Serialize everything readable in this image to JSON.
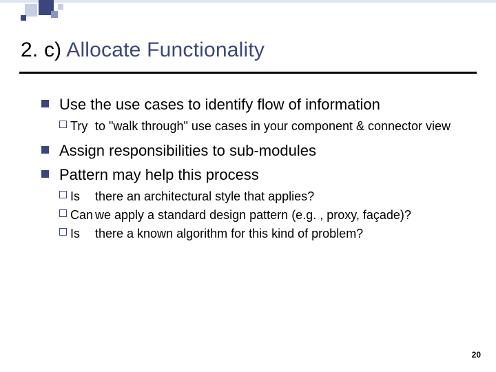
{
  "title": {
    "prefix": "2. c) ",
    "main": "Allocate Functionality"
  },
  "body": {
    "items": [
      {
        "text": "Use the use cases to identify flow of information",
        "sub": [
          {
            "lead": "Try",
            "rest": " to \"walk through\" use cases in your component & connector view"
          }
        ]
      },
      {
        "text": "Assign responsibilities to sub-modules",
        "sub": []
      },
      {
        "text": "Pattern may help this process",
        "sub": [
          {
            "lead": "Is",
            "rest": " there an architectural style that applies?"
          },
          {
            "lead": "Can",
            "rest": " we apply a standard design pattern (e.g. , proxy, façade)?"
          },
          {
            "lead": "Is",
            "rest": " there a known algorithm for this kind of problem?"
          }
        ]
      }
    ]
  },
  "page": "20"
}
